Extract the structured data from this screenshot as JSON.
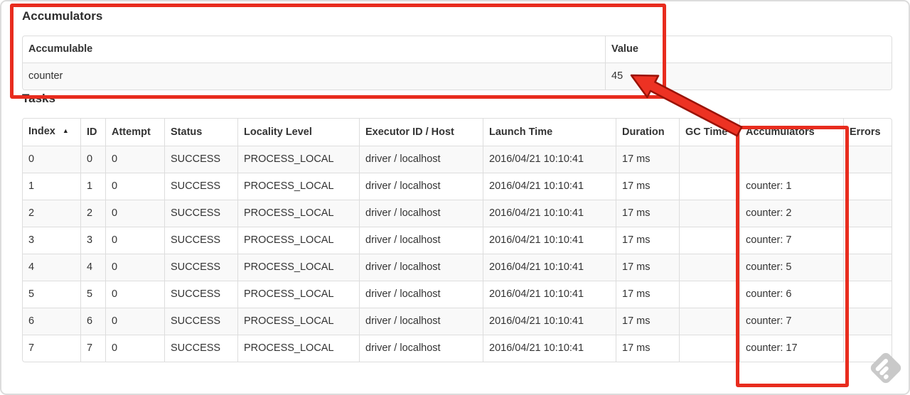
{
  "colors": {
    "annotation_red": "#e82c1e",
    "arrow_fill": "#ed3223",
    "arrow_outline": "#9a1206",
    "table_border": "#dddddd",
    "stripe_bg": "#f9f9f9",
    "text": "#333333",
    "watermark_gray": "#c9c9c9"
  },
  "accumulators_section": {
    "title": "Accumulators",
    "table": {
      "headers": [
        "Accumulable",
        "Value"
      ],
      "rows": [
        {
          "accumulable": "counter",
          "value": "45"
        }
      ]
    }
  },
  "tasks_section": {
    "title": "Tasks",
    "table": {
      "headers": [
        "Index",
        "ID",
        "Attempt",
        "Status",
        "Locality Level",
        "Executor ID / Host",
        "Launch Time",
        "Duration",
        "GC Time",
        "Accumulators",
        "Errors"
      ],
      "sort_indicator": "▲",
      "rows": [
        {
          "index": "0",
          "id": "0",
          "attempt": "0",
          "status": "SUCCESS",
          "locality_level": "PROCESS_LOCAL",
          "executor_id_host": "driver / localhost",
          "launch_time": "2016/04/21 10:10:41",
          "duration": "17 ms",
          "gc_time": "",
          "accumulators": "",
          "errors": ""
        },
        {
          "index": "1",
          "id": "1",
          "attempt": "0",
          "status": "SUCCESS",
          "locality_level": "PROCESS_LOCAL",
          "executor_id_host": "driver / localhost",
          "launch_time": "2016/04/21 10:10:41",
          "duration": "17 ms",
          "gc_time": "",
          "accumulators": "counter: 1",
          "errors": ""
        },
        {
          "index": "2",
          "id": "2",
          "attempt": "0",
          "status": "SUCCESS",
          "locality_level": "PROCESS_LOCAL",
          "executor_id_host": "driver / localhost",
          "launch_time": "2016/04/21 10:10:41",
          "duration": "17 ms",
          "gc_time": "",
          "accumulators": "counter: 2",
          "errors": ""
        },
        {
          "index": "3",
          "id": "3",
          "attempt": "0",
          "status": "SUCCESS",
          "locality_level": "PROCESS_LOCAL",
          "executor_id_host": "driver / localhost",
          "launch_time": "2016/04/21 10:10:41",
          "duration": "17 ms",
          "gc_time": "",
          "accumulators": "counter: 7",
          "errors": ""
        },
        {
          "index": "4",
          "id": "4",
          "attempt": "0",
          "status": "SUCCESS",
          "locality_level": "PROCESS_LOCAL",
          "executor_id_host": "driver / localhost",
          "launch_time": "2016/04/21 10:10:41",
          "duration": "17 ms",
          "gc_time": "",
          "accumulators": "counter: 5",
          "errors": ""
        },
        {
          "index": "5",
          "id": "5",
          "attempt": "0",
          "status": "SUCCESS",
          "locality_level": "PROCESS_LOCAL",
          "executor_id_host": "driver / localhost",
          "launch_time": "2016/04/21 10:10:41",
          "duration": "17 ms",
          "gc_time": "",
          "accumulators": "counter: 6",
          "errors": ""
        },
        {
          "index": "6",
          "id": "6",
          "attempt": "0",
          "status": "SUCCESS",
          "locality_level": "PROCESS_LOCAL",
          "executor_id_host": "driver / localhost",
          "launch_time": "2016/04/21 10:10:41",
          "duration": "17 ms",
          "gc_time": "",
          "accumulators": "counter: 7",
          "errors": ""
        },
        {
          "index": "7",
          "id": "7",
          "attempt": "0",
          "status": "SUCCESS",
          "locality_level": "PROCESS_LOCAL",
          "executor_id_host": "driver / localhost",
          "launch_time": "2016/04/21 10:10:41",
          "duration": "17 ms",
          "gc_time": "",
          "accumulators": "counter: 17",
          "errors": ""
        }
      ]
    }
  },
  "annotations": {
    "highlight_box_top": "accumulators summary",
    "highlight_box_column": "accumulators column",
    "arrow_target": "45"
  },
  "watermark": {
    "name": "skitch"
  }
}
